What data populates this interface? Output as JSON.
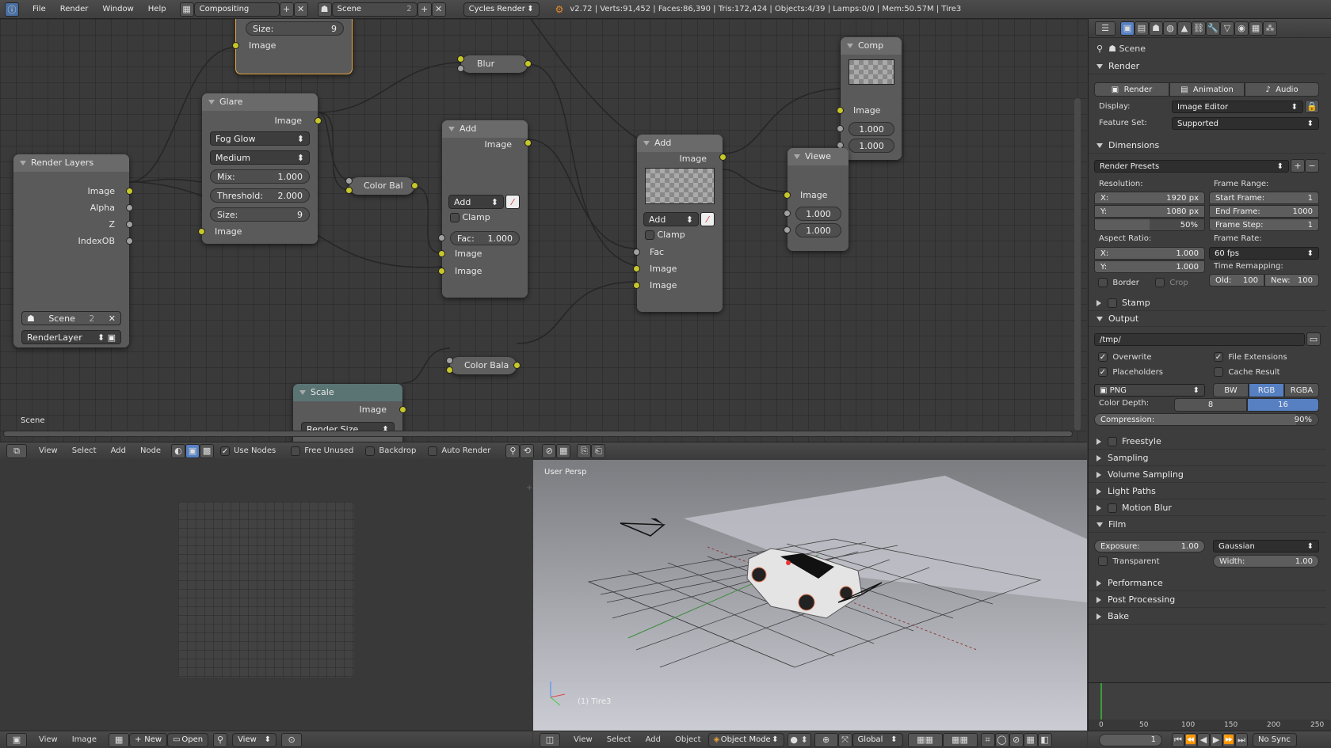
{
  "top": {
    "menus": [
      "File",
      "Render",
      "Window",
      "Help"
    ],
    "layout": "Compositing",
    "scene": "Scene",
    "scene_users": "2",
    "engine": "Cycles Render",
    "stats": "v2.72 | Verts:91,452 | Faces:86,390 | Tris:172,424 | Objects:4/39 | Lamps:0/0 | Mem:50.57M | Tire3"
  },
  "nodes": {
    "scale_top": {
      "size_label": "Size:",
      "size_value": "9",
      "socket": "Image"
    },
    "render_layers": {
      "title": "Render Layers",
      "outputs": [
        "Image",
        "Alpha",
        "Z",
        "IndexOB"
      ],
      "scene": "Scene",
      "scene_users": "2",
      "layer": "RenderLayer"
    },
    "glare": {
      "title": "Glare",
      "output": "Image",
      "type": "Fog Glow",
      "quality": "Medium",
      "mix_label": "Mix:",
      "mix": "1.000",
      "threshold_label": "Threshold:",
      "threshold": "2.000",
      "size_label": "Size:",
      "size": "9",
      "input": "Image"
    },
    "blur": {
      "title": "Blur"
    },
    "color_bal_1": {
      "title": "Color Bal"
    },
    "add1": {
      "title": "Add",
      "output": "Image",
      "mode": "Add",
      "clamp": "Clamp",
      "fac_label": "Fac:",
      "fac": "1.000",
      "inputs": [
        "Image",
        "Image"
      ]
    },
    "add2": {
      "title": "Add",
      "output": "Image",
      "mode": "Add",
      "clamp": "Clamp",
      "inputs": [
        "Fac",
        "Image",
        "Image"
      ]
    },
    "comp": {
      "title": "Comp",
      "input": "Image",
      "v1": "1.000",
      "v2": "1.000"
    },
    "viewer": {
      "title": "Viewe",
      "input": "Image",
      "v1": "1.000",
      "v2": "1.000"
    },
    "color_bal_2": {
      "title": "Color Bala"
    },
    "scale": {
      "title": "Scale",
      "output": "Image",
      "mode": "Render Size"
    },
    "frame_label": "Scene"
  },
  "node_header": {
    "menus": [
      "View",
      "Select",
      "Add",
      "Node"
    ],
    "use_nodes": "Use Nodes",
    "free_unused": "Free Unused",
    "backdrop": "Backdrop",
    "auto_render": "Auto Render"
  },
  "viewport": {
    "label": "User Persp",
    "object": "(1) Tire3",
    "menus": [
      "View",
      "Select",
      "Add",
      "Object"
    ],
    "mode": "Object Mode",
    "orientation": "Global"
  },
  "image_header": {
    "menus": [
      "View",
      "Image"
    ],
    "new": "New",
    "open": "Open",
    "view": "View"
  },
  "props": {
    "scene": "Scene",
    "render_title": "Render",
    "render_btn": "Render",
    "anim_btn": "Animation",
    "audio_btn": "Audio",
    "display_label": "Display:",
    "display": "Image Editor",
    "feature_label": "Feature Set:",
    "feature": "Supported",
    "dimensions": "Dimensions",
    "presets": "Render Presets",
    "resolution": "Resolution:",
    "res_x_label": "X:",
    "res_x": "1920 px",
    "res_y_label": "Y:",
    "res_y": "1080 px",
    "res_pct": "50%",
    "frame_range": "Frame Range:",
    "start_label": "Start Frame:",
    "start": "1",
    "end_label": "End Frame:",
    "end": "1000",
    "step_label": "Frame Step:",
    "step": "1",
    "aspect": "Aspect Ratio:",
    "asp_x_label": "X:",
    "asp_x": "1.000",
    "asp_y_label": "Y:",
    "asp_y": "1.000",
    "frame_rate": "Frame Rate:",
    "fps": "60 fps",
    "time_remap": "Time Remapping:",
    "old_label": "Old:",
    "old": "100",
    "new_label": "New:",
    "new": "100",
    "border": "Border",
    "crop": "Crop",
    "stamp": "Stamp",
    "output": "Output",
    "path": "/tmp/",
    "overwrite": "Overwrite",
    "file_ext": "File Extensions",
    "placeholders": "Placeholders",
    "cache": "Cache Result",
    "format": "PNG",
    "bw": "BW",
    "rgb": "RGB",
    "rgba": "RGBA",
    "depth_label": "Color Depth:",
    "d8": "8",
    "d16": "16",
    "compression_label": "Compression:",
    "compression": "90%",
    "freestyle": "Freestyle",
    "sampling": "Sampling",
    "volume": "Volume Sampling",
    "light": "Light Paths",
    "motion": "Motion Blur",
    "film": "Film",
    "exposure_label": "Exposure:",
    "exposure": "1.00",
    "filter": "Gaussian",
    "transparent": "Transparent",
    "width_label": "Width:",
    "width": "1.00",
    "performance": "Performance",
    "post": "Post Processing",
    "bake": "Bake"
  },
  "timeline": {
    "ticks": [
      "0",
      "50",
      "100",
      "150",
      "200",
      "250"
    ],
    "frame": "1",
    "sync": "No Sync"
  },
  "colors": {
    "socket": "#c7c729",
    "accent": "#5680c2"
  }
}
